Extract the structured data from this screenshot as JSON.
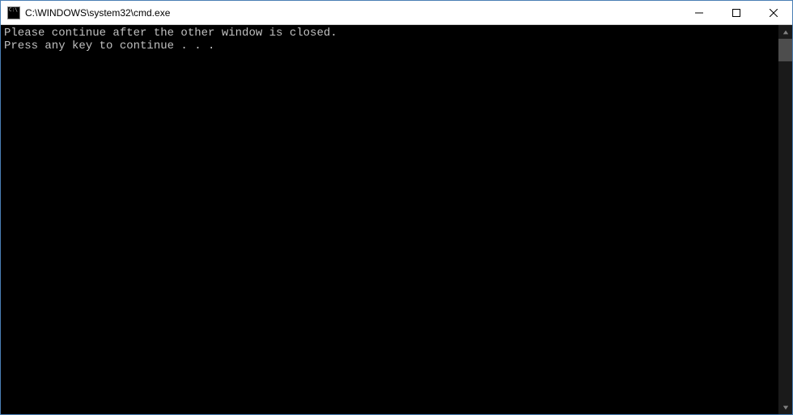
{
  "window": {
    "title": "C:\\WINDOWS\\system32\\cmd.exe"
  },
  "terminal": {
    "lines": [
      "Please continue after the other window is closed.",
      "Press any key to continue . . ."
    ]
  }
}
